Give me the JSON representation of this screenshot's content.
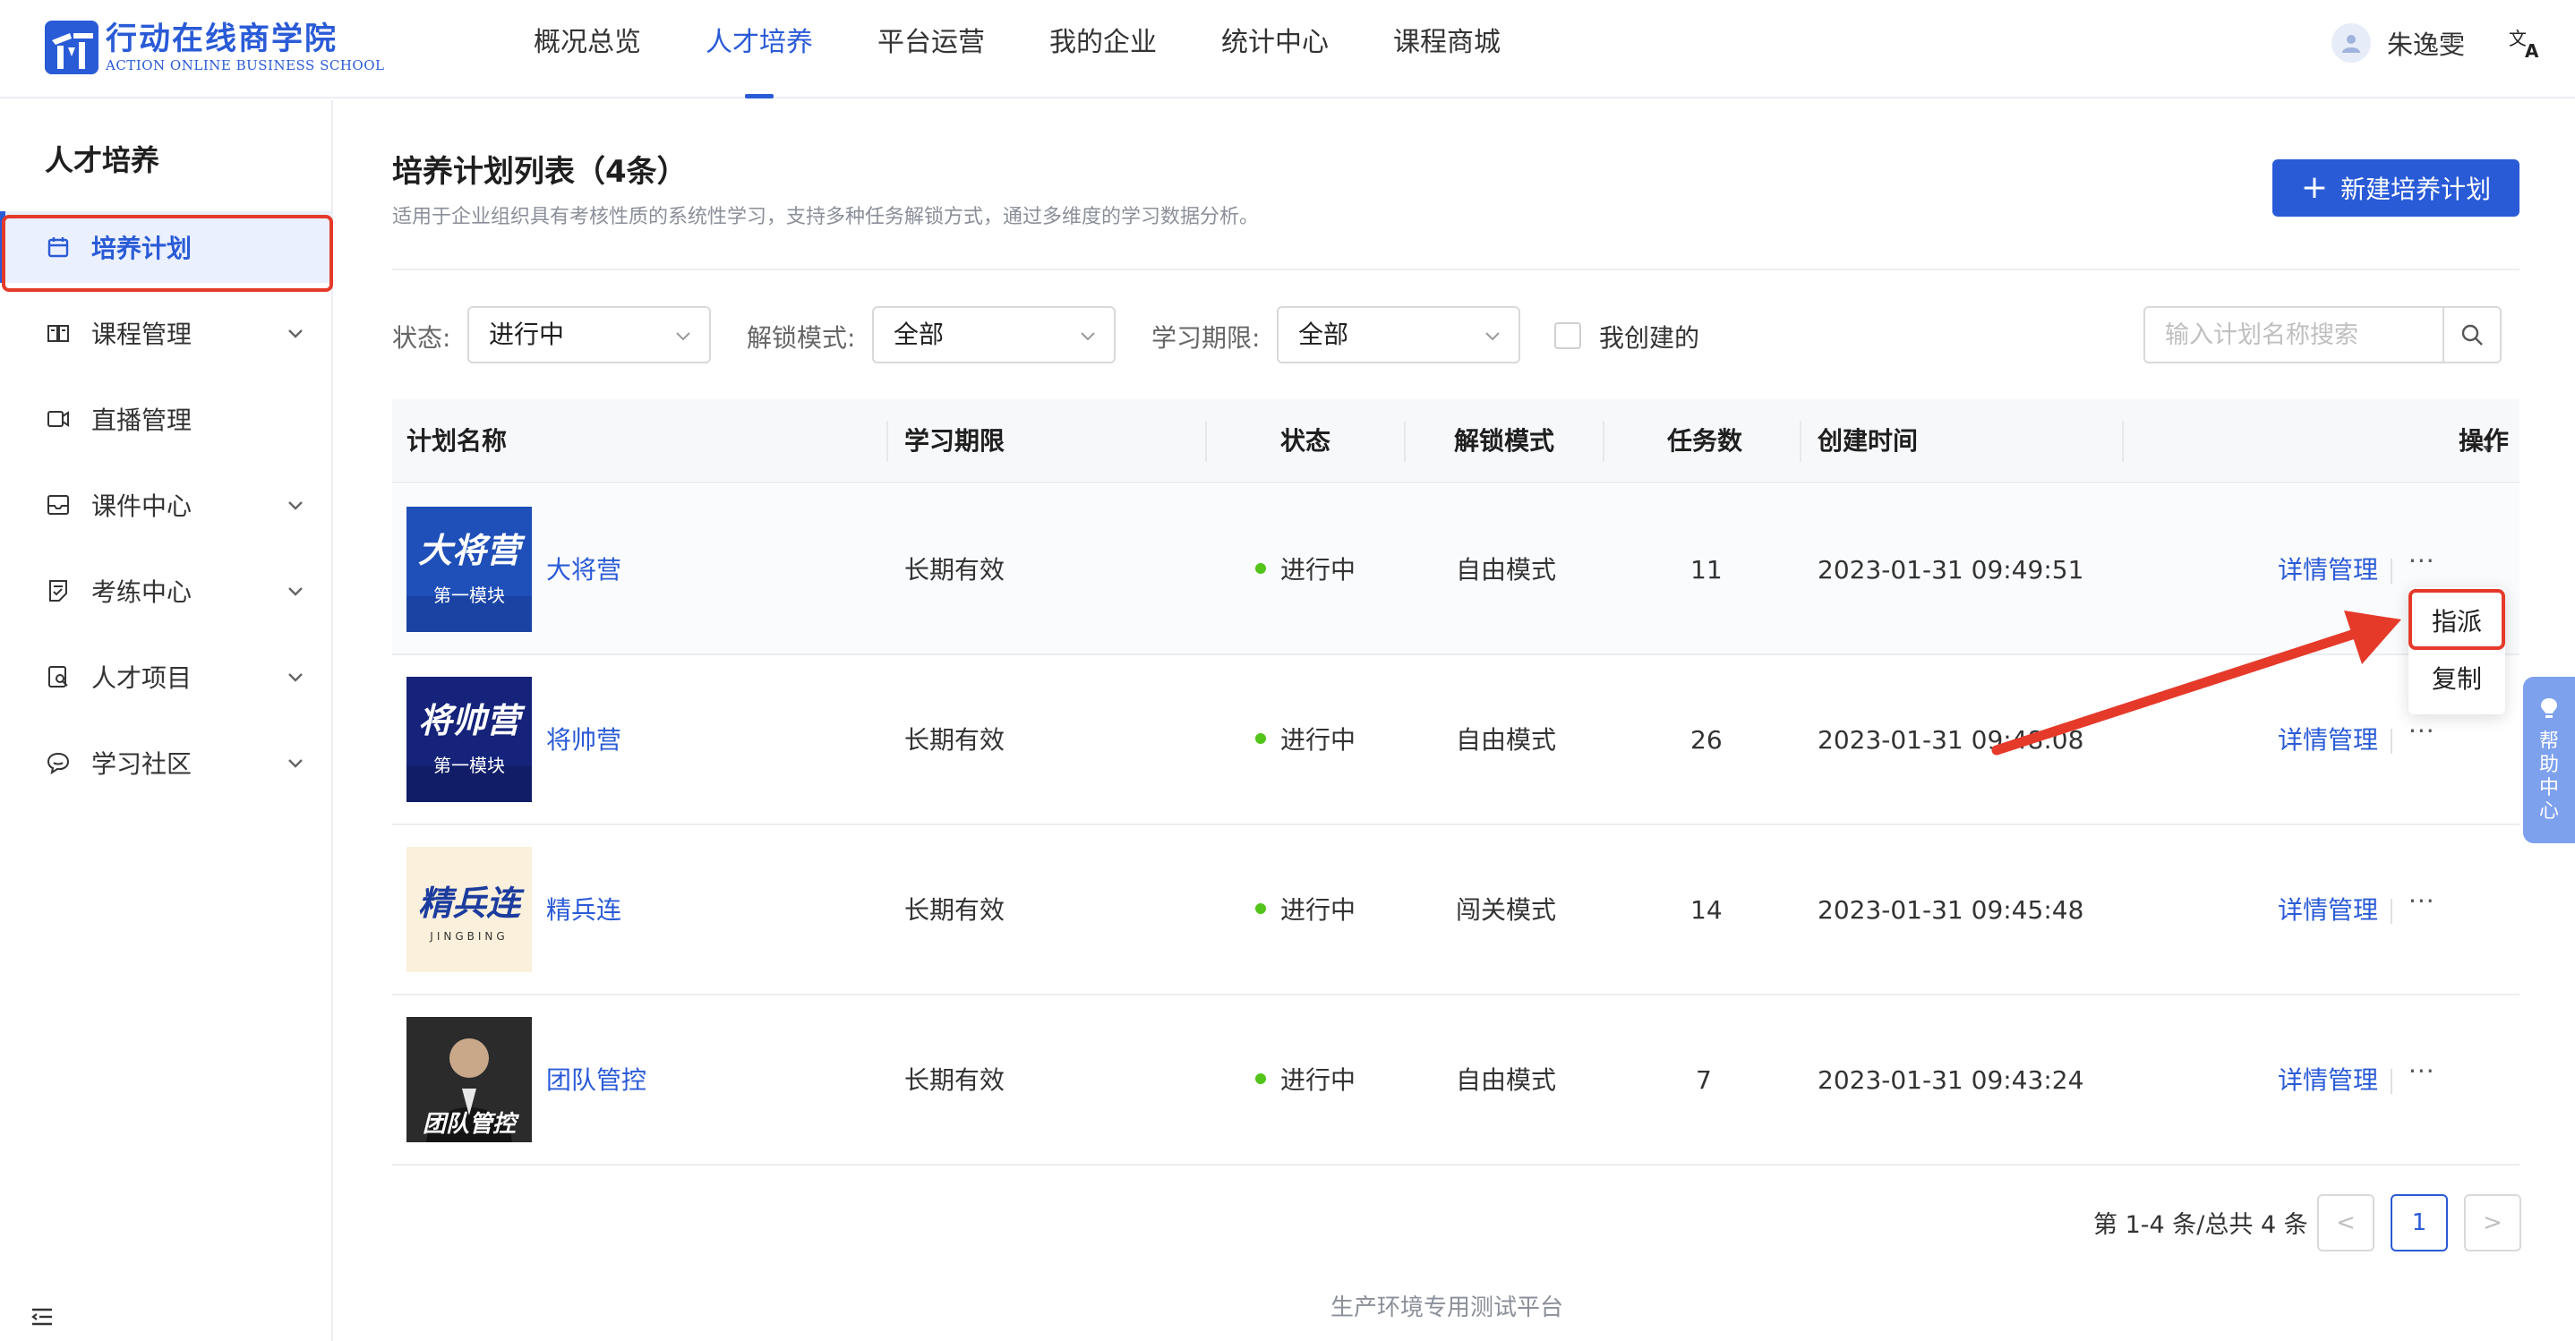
{
  "header": {
    "logo_cn": "行动在线商学院",
    "logo_en": "ACTION ONLINE BUSINESS SCHOOL",
    "nav": [
      "概况总览",
      "人才培养",
      "平台运营",
      "我的企业",
      "统计中心",
      "课程商城"
    ],
    "active_nav": "人才培养",
    "user_name": "朱逸雯",
    "lang_icon": "translate-icon"
  },
  "sidebar": {
    "title": "人才培养",
    "items": [
      {
        "label": "培养计划",
        "icon": "calendar-icon",
        "active": true,
        "expandable": false
      },
      {
        "label": "课程管理",
        "icon": "book-icon",
        "active": false,
        "expandable": true
      },
      {
        "label": "直播管理",
        "icon": "video-icon",
        "active": false,
        "expandable": false
      },
      {
        "label": "课件中心",
        "icon": "inbox-icon",
        "active": false,
        "expandable": true
      },
      {
        "label": "考练中心",
        "icon": "exam-icon",
        "active": false,
        "expandable": true
      },
      {
        "label": "人才项目",
        "icon": "project-icon",
        "active": false,
        "expandable": true
      },
      {
        "label": "学习社区",
        "icon": "chat-icon",
        "active": false,
        "expandable": true
      }
    ]
  },
  "main": {
    "title": "培养计划列表（4条）",
    "subtitle": "适用于企业组织具有考核性质的系统性学习，支持多种任务解锁方式，通过多维度的学习数据分析。",
    "new_button": "新建培养计划",
    "filters": {
      "status_label": "状态:",
      "status_value": "进行中",
      "unlock_label": "解锁模式:",
      "unlock_value": "全部",
      "period_label": "学习期限:",
      "period_value": "全部",
      "mine_label": "我创建的",
      "search_placeholder": "输入计划名称搜索"
    },
    "table": {
      "columns": [
        "计划名称",
        "学习期限",
        "状态",
        "解锁模式",
        "任务数",
        "创建时间",
        "操作"
      ],
      "rows": [
        {
          "thumb_title": "大将营",
          "thumb_sub": "第一模块",
          "name": "大将营",
          "period": "长期有效",
          "status": "进行中",
          "unlock": "自由模式",
          "tasks": "11",
          "created": "2023-01-31 09:49:51",
          "action": "详情管理",
          "more": "···"
        },
        {
          "thumb_title": "将帅营",
          "thumb_sub": "第一模块",
          "name": "将帅营",
          "period": "长期有效",
          "status": "进行中",
          "unlock": "自由模式",
          "tasks": "26",
          "created": "2023-01-31 09:48:08",
          "action": "详情管理",
          "more": "···"
        },
        {
          "thumb_title": "精兵连",
          "thumb_sub": "JINGBING",
          "name": "精兵连",
          "period": "长期有效",
          "status": "进行中",
          "unlock": "闯关模式",
          "tasks": "14",
          "created": "2023-01-31 09:45:48",
          "action": "详情管理",
          "more": "···"
        },
        {
          "thumb_title": "团队管控",
          "thumb_sub": "",
          "name": "团队管控",
          "period": "长期有效",
          "status": "进行中",
          "unlock": "自由模式",
          "tasks": "7",
          "created": "2023-01-31 09:43:24",
          "action": "详情管理",
          "more": "···"
        }
      ]
    },
    "dropdown": [
      "指派",
      "复制"
    ],
    "pagination": {
      "total_text": "第 1-4 条/总共 4 条",
      "prev": "<",
      "current": "1",
      "next": ">"
    },
    "footer": "生产环境专用测试平台"
  },
  "help": {
    "label": "帮助中心",
    "icon": "lightbulb-icon"
  },
  "colors": {
    "primary": "#2a5bd7",
    "annotation": "#e53a2a",
    "status_dot": "#52c41a",
    "help_tab": "#7ea1ee"
  }
}
